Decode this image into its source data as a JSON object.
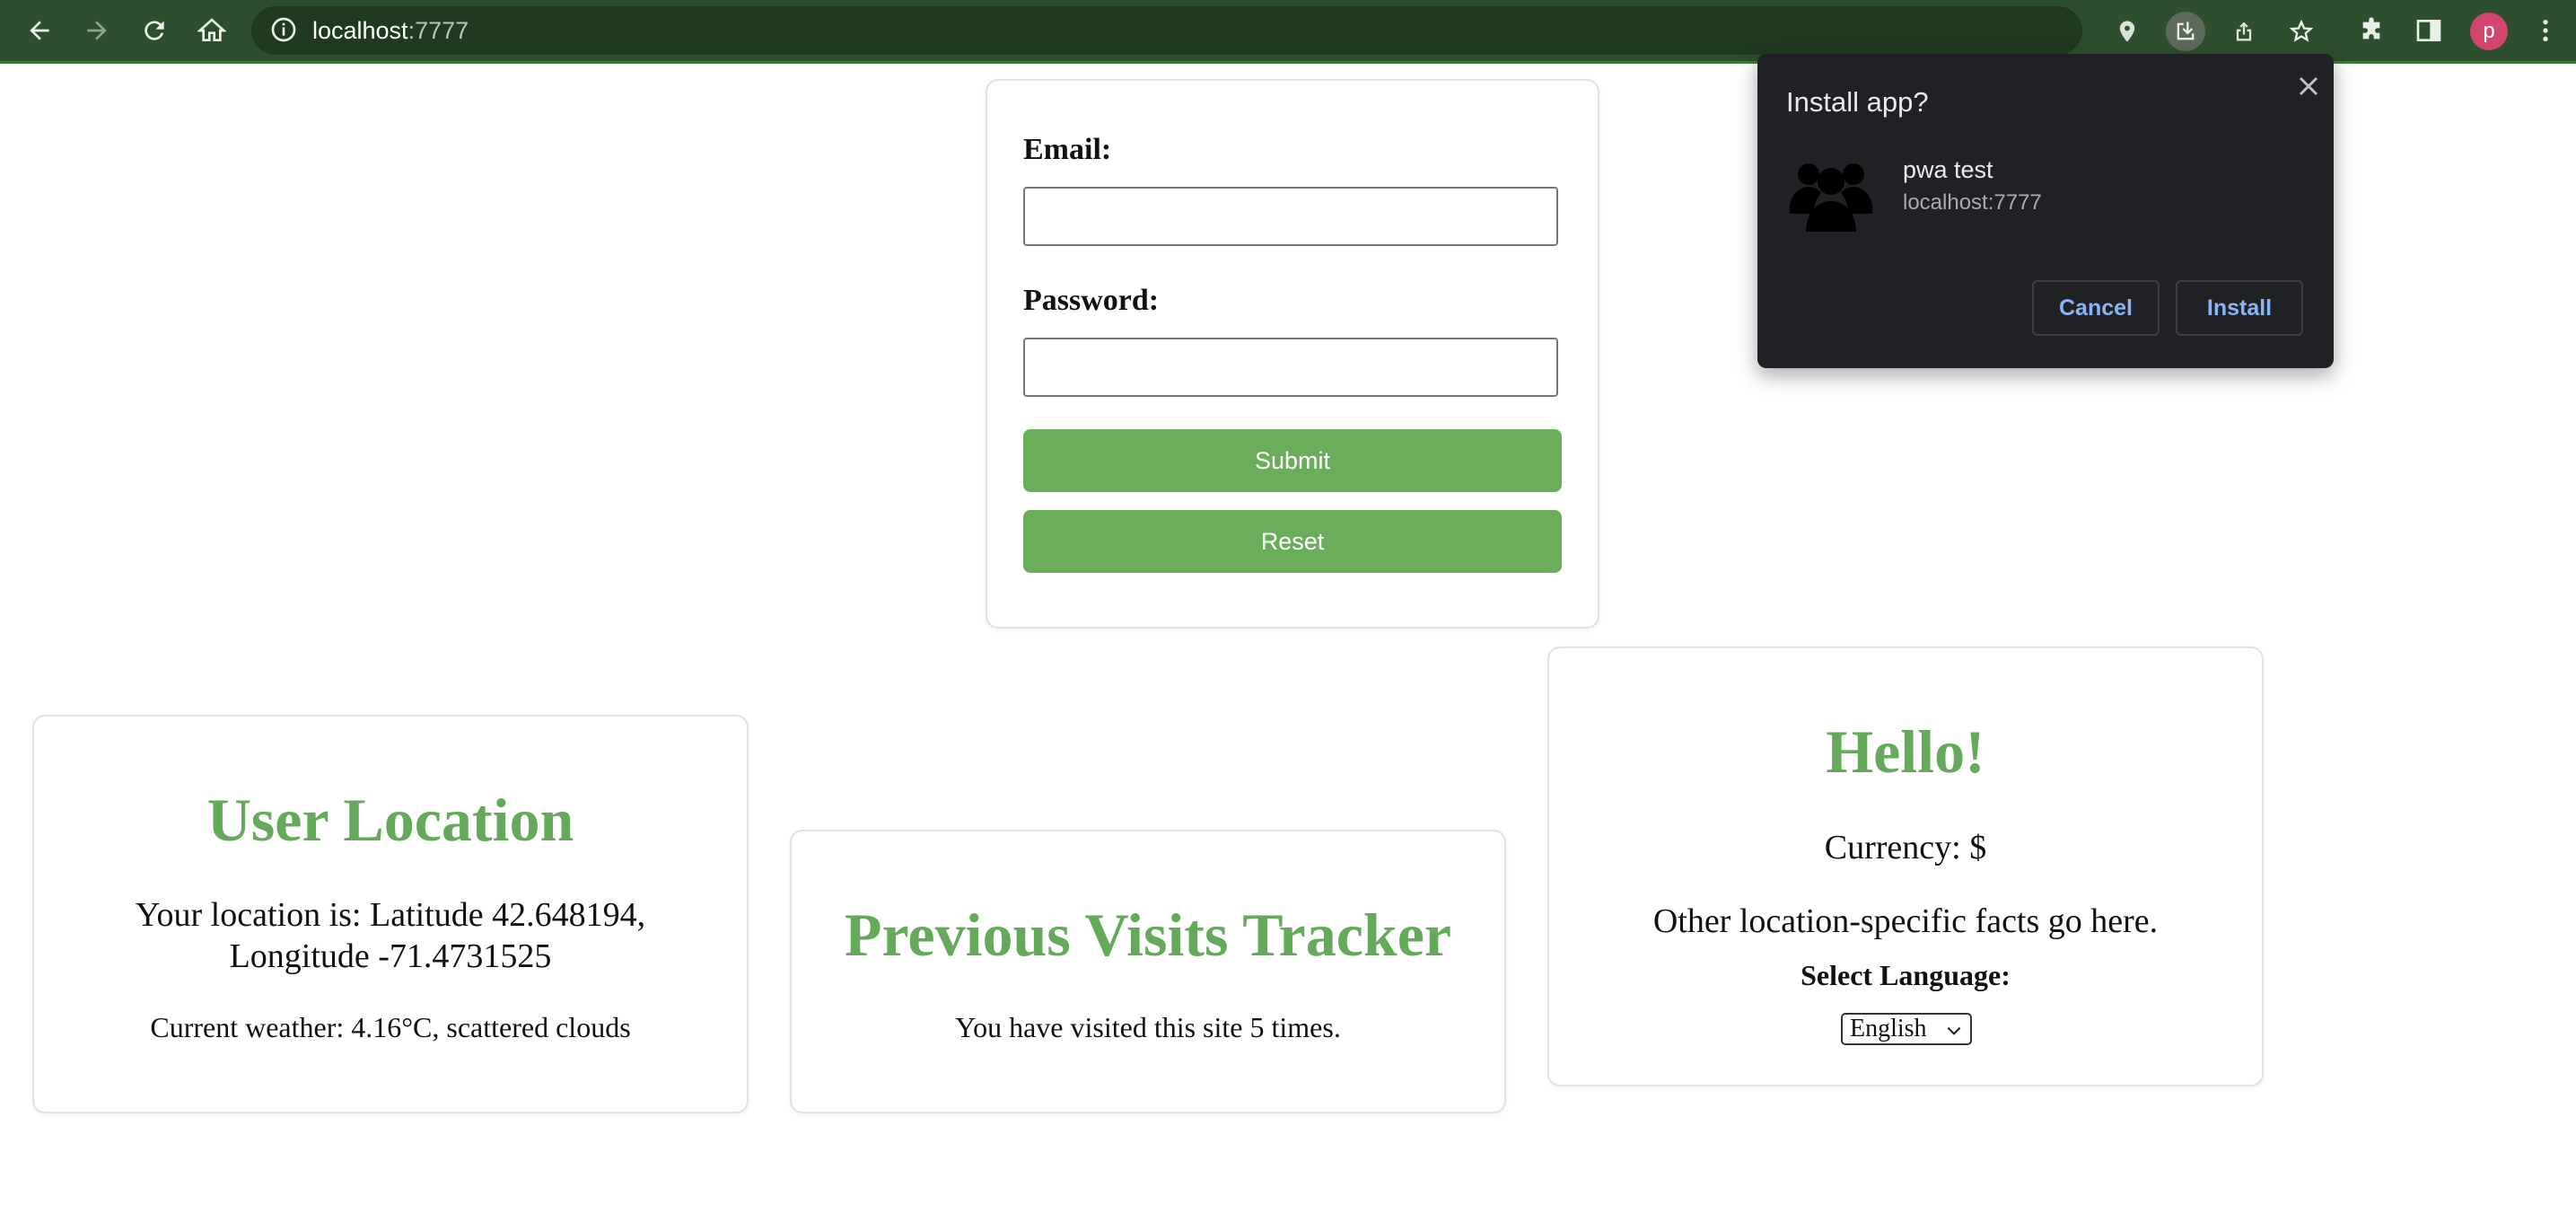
{
  "browser": {
    "url_host": "localhost",
    "url_port": ":7777",
    "profile_initial": "p"
  },
  "form": {
    "email_label": "Email:",
    "email_value": "",
    "password_label": "Password:",
    "password_value": "",
    "submit_label": "Submit",
    "reset_label": "Reset"
  },
  "location_card": {
    "title": "User Location",
    "location_line1": "Your location is: Latitude 42.648194,",
    "location_line2": "Longitude -71.4731525",
    "weather": "Current weather: 4.16°C, scattered clouds"
  },
  "visits_card": {
    "title": "Previous Visits Tracker",
    "text": "You have visited this site 5 times."
  },
  "hello_card": {
    "title": "Hello!",
    "currency": "Currency: $",
    "facts": "Other location-specific facts go here.",
    "language_label": "Select Language:",
    "language_selected": "English"
  },
  "install_dialog": {
    "title": "Install app?",
    "app_name": "pwa test",
    "origin": "localhost:7777",
    "cancel_label": "Cancel",
    "install_label": "Install"
  },
  "colors": {
    "accent_green": "#65aa5b",
    "button_green": "#6aad5b",
    "toolbar": "#2e4f2d",
    "dialog_bg": "#202124",
    "dialog_link": "#8ab4f8",
    "avatar": "#d2456e"
  }
}
